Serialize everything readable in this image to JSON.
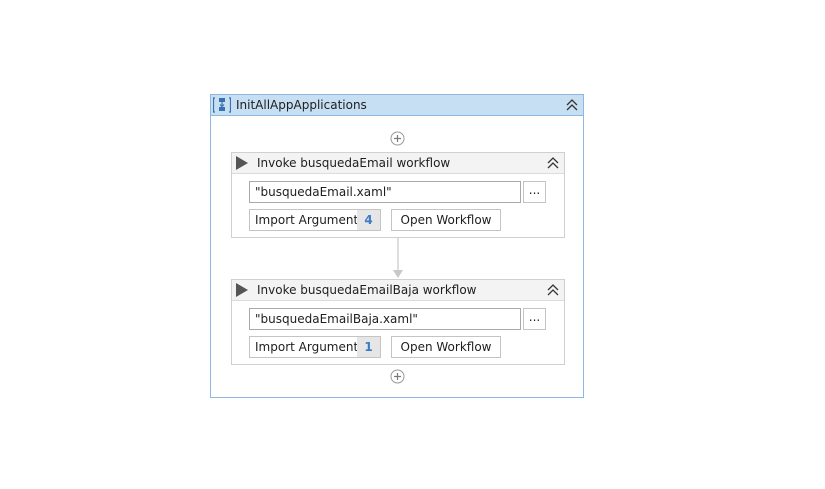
{
  "sequence": {
    "title": "InitAllAppApplications",
    "icon": "sequence-icon",
    "collapse_icon": "double-chevron-up-icon",
    "add_icon": "add-circle-icon"
  },
  "activities": [
    {
      "title": "Invoke busquedaEmail workflow",
      "file_path": "\"busquedaEmail.xaml\"",
      "browse_label": "...",
      "import_label": "Import Arguments",
      "import_count": "4",
      "open_label": "Open Workflow",
      "icon": "play-icon"
    },
    {
      "title": "Invoke busquedaEmailBaja workflow",
      "file_path": "\"busquedaEmailBaja.xaml\"",
      "browse_label": "...",
      "import_label": "Import Arguments",
      "import_count": "1",
      "open_label": "Open Workflow",
      "icon": "play-icon"
    }
  ],
  "colors": {
    "sequence_header": "#c6dff3",
    "sequence_border": "#8fb8e0",
    "activity_header": "#f3f3f3",
    "count_text": "#3b7cc4"
  }
}
